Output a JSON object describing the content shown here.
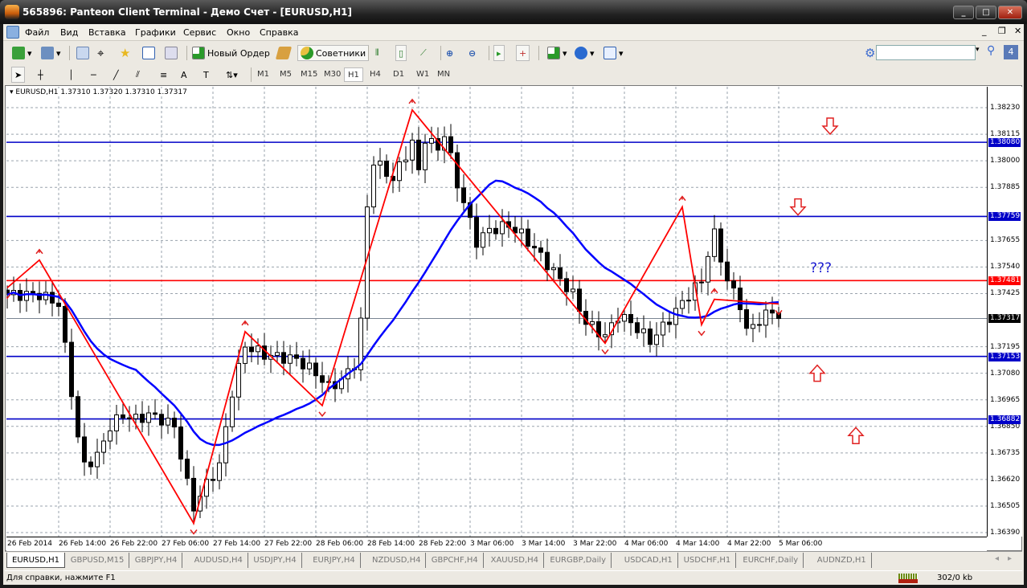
{
  "window": {
    "title": "565896: Panteon Client Terminal - Демо Счет - [EURUSD,H1]"
  },
  "menu": [
    "Файл",
    "Вид",
    "Вставка",
    "Графики",
    "Сервис",
    "Окно",
    "Справка"
  ],
  "toolbar": {
    "new_order": "Новый Ордер",
    "experts": "Советники",
    "search_value": "",
    "notification_count": "4"
  },
  "timeframes": [
    "M1",
    "M5",
    "M15",
    "M30",
    "H1",
    "H4",
    "D1",
    "W1",
    "MN"
  ],
  "active_timeframe": "H1",
  "chart": {
    "symbol_info": "EURUSD,H1  1.37310 1.37320 1.37310 1.37317",
    "annotation": "???",
    "colors": {
      "level": "#0000c8",
      "resistance": "#ff0000",
      "zigzag": "#ff0000",
      "ma": "#0000ff",
      "current": "#000000"
    }
  },
  "chart_data": {
    "type": "candlestick",
    "symbol": "EURUSD",
    "timeframe": "H1",
    "ylim": [
      1.3639,
      1.3832
    ],
    "price_ticks": [
      "1.38230",
      "1.38115",
      "1.38000",
      "1.37885",
      "1.37655",
      "1.37540",
      "1.37425",
      "1.37195",
      "1.37080",
      "1.36965",
      "1.36850",
      "1.36735",
      "1.36620",
      "1.36505",
      "1.36390"
    ],
    "time_ticks": [
      "26 Feb 2014",
      "26 Feb 14:00",
      "26 Feb 22:00",
      "27 Feb 06:00",
      "27 Feb 14:00",
      "27 Feb 22:00",
      "28 Feb 06:00",
      "28 Feb 14:00",
      "28 Feb 22:00",
      "3 Mar 06:00",
      "3 Mar 14:00",
      "3 Mar 22:00",
      "4 Mar 06:00",
      "4 Mar 14:00",
      "4 Mar 22:00",
      "5 Mar 06:00"
    ],
    "close_keypoints": [
      [
        0,
        1.3742
      ],
      [
        5,
        1.3742
      ],
      [
        8,
        1.3738
      ],
      [
        10,
        1.37
      ],
      [
        11,
        1.368
      ],
      [
        12,
        1.3668
      ],
      [
        14,
        1.3672
      ],
      [
        16,
        1.3685
      ],
      [
        18,
        1.369
      ],
      [
        20,
        1.3688
      ],
      [
        22,
        1.369
      ],
      [
        24,
        1.3688
      ],
      [
        26,
        1.3685
      ],
      [
        28,
        1.366
      ],
      [
        29,
        1.365
      ],
      [
        31,
        1.366
      ],
      [
        33,
        1.3668
      ],
      [
        35,
        1.37
      ],
      [
        37,
        1.372
      ],
      [
        40,
        1.3716
      ],
      [
        45,
        1.3714
      ],
      [
        48,
        1.3708
      ],
      [
        50,
        1.3702
      ],
      [
        52,
        1.3705
      ],
      [
        54,
        1.3712
      ],
      [
        55,
        1.373
      ],
      [
        56,
        1.378
      ],
      [
        57,
        1.38
      ],
      [
        60,
        1.3792
      ],
      [
        63,
        1.3808
      ],
      [
        64,
        1.3795
      ],
      [
        65,
        1.381
      ],
      [
        67,
        1.3805
      ],
      [
        68,
        1.3812
      ],
      [
        70,
        1.379
      ],
      [
        71,
        1.3782
      ],
      [
        73,
        1.3765
      ],
      [
        75,
        1.377
      ],
      [
        78,
        1.3772
      ],
      [
        80,
        1.3768
      ],
      [
        82,
        1.3762
      ],
      [
        85,
        1.3752
      ],
      [
        88,
        1.3742
      ],
      [
        90,
        1.373
      ],
      [
        93,
        1.3724
      ],
      [
        95,
        1.3733
      ],
      [
        97,
        1.373
      ],
      [
        100,
        1.3722
      ],
      [
        102,
        1.3728
      ],
      [
        104,
        1.3735
      ],
      [
        106,
        1.3742
      ],
      [
        108,
        1.3748
      ],
      [
        109,
        1.376
      ],
      [
        110,
        1.3768
      ],
      [
        111,
        1.3758
      ],
      [
        112,
        1.3748
      ],
      [
        114,
        1.3738
      ],
      [
        115,
        1.3726
      ],
      [
        117,
        1.3731
      ],
      [
        119,
        1.3735
      ],
      [
        120,
        1.3738
      ],
      [
        122,
        1.3737
      ],
      [
        124,
        1.3734
      ],
      [
        126,
        1.3732
      ]
    ],
    "ma_period": 21,
    "zigzag": [
      [
        0,
        1.3745
      ],
      [
        5,
        1.3757
      ],
      [
        29,
        1.3643
      ],
      [
        37,
        1.3726
      ],
      [
        49,
        1.3694
      ],
      [
        63,
        1.3822
      ],
      [
        93,
        1.3721
      ],
      [
        105,
        1.378
      ],
      [
        108,
        1.3729
      ],
      [
        110,
        1.374
      ],
      [
        120,
        1.3738
      ]
    ],
    "levels": [
      {
        "price": 1.3808,
        "label": "1.38080",
        "color": "#0000c8"
      },
      {
        "price": 1.37759,
        "label": "1.37759",
        "color": "#0000c8"
      },
      {
        "price": 1.37481,
        "label": "1.37481",
        "color": "#ff0000"
      },
      {
        "price": 1.37317,
        "label": "1.37317",
        "color": "#000000"
      },
      {
        "price": 1.37153,
        "label": "1.37153",
        "color": "#0000c8"
      },
      {
        "price": 1.36882,
        "label": "1.36882",
        "color": "#0000c8"
      }
    ],
    "arrows": [
      {
        "dir": "down",
        "bar": 128,
        "price": 1.3815
      },
      {
        "dir": "down",
        "bar": 123,
        "price": 1.378
      },
      {
        "dir": "up",
        "bar": 126,
        "price": 1.3708
      },
      {
        "dir": "up",
        "bar": 132,
        "price": 1.3681
      }
    ]
  },
  "tabs": [
    "EURUSD,H1",
    "GBPUSD,M15",
    "GBPJPY,H4",
    "AUDUSD,H4",
    "USDJPY,H4",
    "EURJPY,H4",
    "NZDUSD,H4",
    "GBPCHF,H4",
    "XAUUSD,H4",
    "EURGBP,Daily",
    "USDCAD,H1",
    "USDCHF,H1",
    "EURCHF,Daily",
    "AUDNZD,H1"
  ],
  "status": {
    "help": "Для справки, нажмите F1",
    "traffic": "302/0 kb"
  }
}
